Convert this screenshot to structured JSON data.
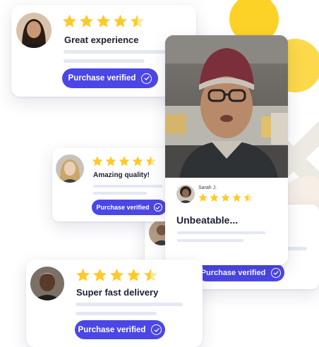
{
  "colors": {
    "accent": "#4b46e6",
    "star": "#ffc928",
    "yellow_circle": "#fcd227",
    "text": "#1d1f33",
    "placeholder_line": "#e3e8f3"
  },
  "reviews": [
    {
      "id": "card1",
      "title": "Great experience",
      "rating": 4.5,
      "verified_label": "Purchase verified"
    },
    {
      "id": "card2",
      "title": "Amazing quality!",
      "rating": 4.5,
      "verified_label": "Purchase verified"
    },
    {
      "id": "card3",
      "title": "Super fast delivery",
      "rating": 4.5,
      "verified_label": "Purchase verified"
    },
    {
      "id": "card4",
      "title": "",
      "rating": 0,
      "verified_label": "Purchase verified"
    }
  ],
  "video_review": {
    "reviewer_name": "Sarah J.",
    "rating": 4.5,
    "title": "Unbeatable..."
  },
  "icons": {
    "star": "star-icon",
    "check": "check-circle-icon"
  }
}
